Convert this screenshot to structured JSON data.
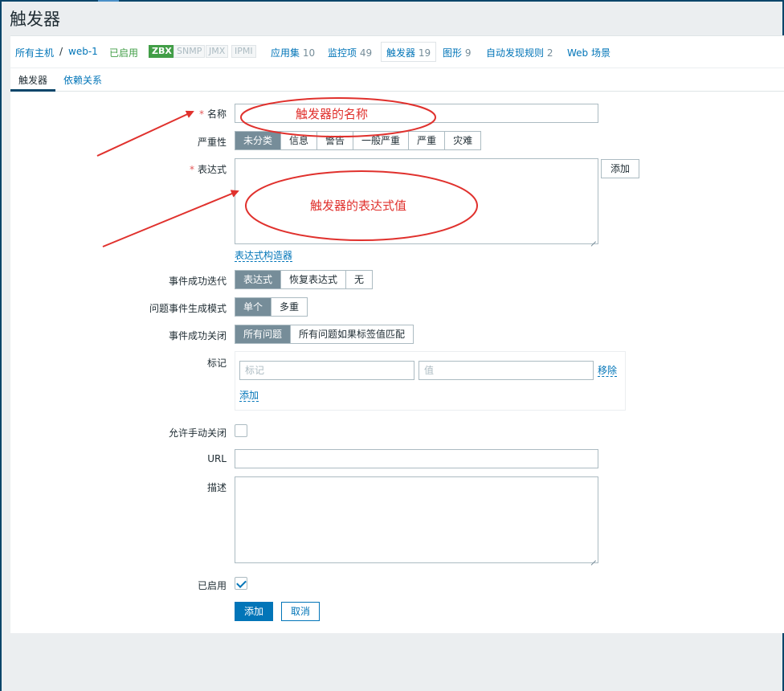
{
  "page": {
    "title": "触发器"
  },
  "host_nav": {
    "all_hosts": "所有主机",
    "separator": "/",
    "host": "web-1",
    "status": "已启用",
    "badges": [
      "ZBX",
      "SNMP",
      "JMX",
      "IPMI"
    ],
    "apps_label": "应用集",
    "apps_count": "10",
    "items_label": "监控项",
    "items_count": "49",
    "triggers_label": "触发器",
    "triggers_count": "19",
    "graphs_label": "图形",
    "graphs_count": "9",
    "discovery_label": "自动发现规则",
    "discovery_count": "2",
    "web_label": "Web 场景"
  },
  "tabs": {
    "trigger": "触发器",
    "dependencies": "依赖关系"
  },
  "form": {
    "name_label": "名称",
    "name_value": "",
    "severity_label": "严重性",
    "severity_options": [
      "未分类",
      "信息",
      "警告",
      "一般严重",
      "严重",
      "灾难"
    ],
    "severity_selected": "未分类",
    "expression_label": "表达式",
    "expression_value": "",
    "add_button": "添加",
    "expression_constructor": "表达式构造器",
    "ok_event_label": "事件成功迭代",
    "ok_event_options": [
      "表达式",
      "恢复表达式",
      "无"
    ],
    "problem_mode_label": "问题事件生成模式",
    "problem_mode_options": [
      "单个",
      "多重"
    ],
    "ok_close_label": "事件成功关闭",
    "ok_close_options": [
      "所有问题",
      "所有问题如果标签值匹配"
    ],
    "tags_label": "标记",
    "tag_placeholder": "标记",
    "value_placeholder": "值",
    "remove_link": "移除",
    "add_link": "添加",
    "manual_close_label": "允许手动关闭",
    "manual_close_checked": false,
    "url_label": "URL",
    "url_value": "",
    "description_label": "描述",
    "description_value": "",
    "enabled_label": "已启用",
    "enabled_checked": true,
    "submit_button": "添加",
    "cancel_button": "取消"
  },
  "annotations": {
    "name_note": "触发器的名称",
    "expression_note": "触发器的表达式值",
    "color": "#e0312d"
  }
}
